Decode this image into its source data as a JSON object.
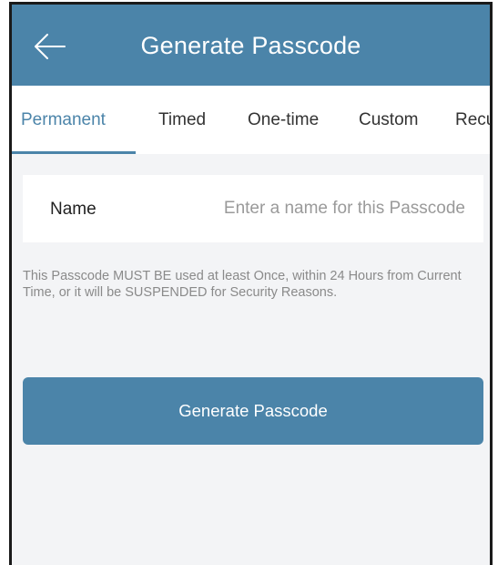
{
  "header": {
    "title": "Generate Passcode",
    "back_icon": "arrow-left-icon"
  },
  "tabs": [
    {
      "label": "Permanent",
      "active": true
    },
    {
      "label": "Timed",
      "active": false
    },
    {
      "label": "One-time",
      "active": false
    },
    {
      "label": "Custom",
      "active": false
    },
    {
      "label": "Recu",
      "active": false
    }
  ],
  "form": {
    "name_label": "Name",
    "name_value": "",
    "name_placeholder": "Enter a name for this Passcode"
  },
  "notice": "This Passcode MUST BE used at least Once, within 24 Hours from Current Time, or it will be SUSPENDED for Security Reasons.",
  "actions": {
    "generate_label": "Generate Passcode"
  },
  "colors": {
    "accent": "#4b84a9",
    "background": "#f3f4f6",
    "muted_text": "#8a8a8a"
  }
}
